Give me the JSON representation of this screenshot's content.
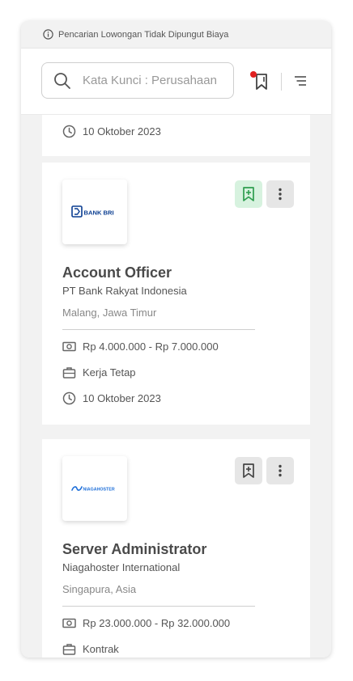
{
  "notice": {
    "text": "Pencarian Lowongan Tidak Dipungut Biaya",
    "icon": "info-icon"
  },
  "header": {
    "search_placeholder": "Kata Kunci : Perusahaan",
    "search_icon": "search-icon",
    "bookmark_icon": "bookmark-icon",
    "filter_icon": "filter-icon",
    "notification_color": "#e02020"
  },
  "partial_card": {
    "date": "10 Oktober 2023"
  },
  "jobs": [
    {
      "logo_text": "BANK BRI",
      "title": "Account Officer",
      "company": "PT Bank Rakyat Indonesia",
      "location": "Malang, Jawa Timur",
      "salary": "Rp 4.000.000 - Rp 7.000.000",
      "type": "Kerja Tetap",
      "date": "10 Oktober 2023",
      "saved": true
    },
    {
      "logo_text": "NIAGAHOSTER",
      "title": "Server Administrator",
      "company": "Niagahoster International",
      "location": "Singapura, Asia",
      "salary": "Rp 23.000.000 - Rp 32.000.000",
      "type": "Kontrak",
      "saved": false
    }
  ],
  "colors": {
    "accent_green": "#2e9e4f",
    "bri_blue": "#0a3d91",
    "niaga_blue": "#1e6fd9"
  }
}
